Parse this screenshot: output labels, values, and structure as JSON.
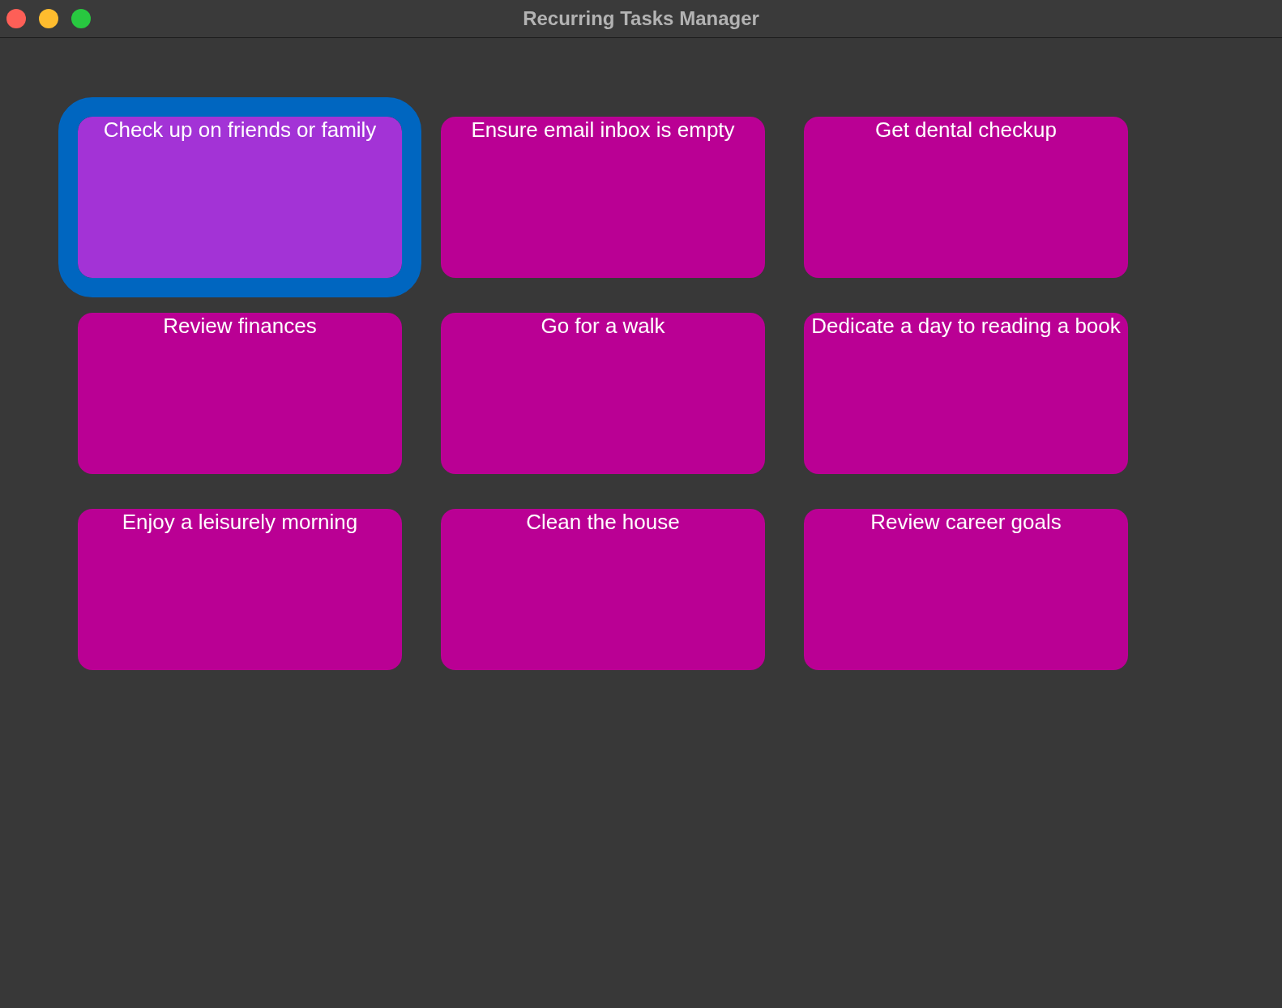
{
  "window": {
    "title": "Recurring Tasks Manager"
  },
  "tasks": [
    {
      "label": "Check up on friends or family",
      "selected": true
    },
    {
      "label": "Ensure email inbox is empty",
      "selected": false
    },
    {
      "label": "Get dental checkup",
      "selected": false
    },
    {
      "label": "Review finances",
      "selected": false
    },
    {
      "label": "Go for a walk",
      "selected": false
    },
    {
      "label": "Dedicate a day to reading a book",
      "selected": false
    },
    {
      "label": "Enjoy a leisurely morning",
      "selected": false
    },
    {
      "label": "Clean the house",
      "selected": false
    },
    {
      "label": "Review career goals",
      "selected": false
    }
  ]
}
